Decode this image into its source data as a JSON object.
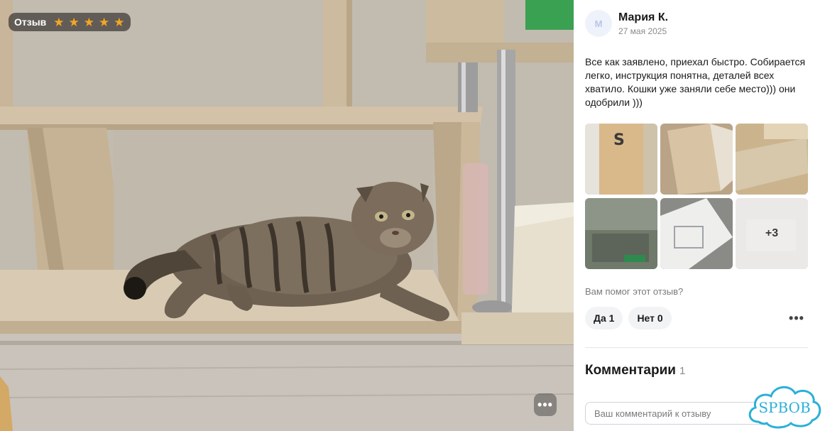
{
  "photo": {
    "rating_label": "Отзыв",
    "rating_value": 5,
    "more_icon": "ellipsis-icon"
  },
  "review": {
    "author": {
      "initials": "М",
      "name": "Мария К.",
      "date": "27 мая 2025"
    },
    "text": "Все как заявлено, приехал быстро. Собирается легко, инструкция понятна, деталей всех хватило. Кошки уже заняли себе место))) они одобрили )))",
    "more_photos_label": "+3",
    "helpful_question": "Вам помог этот отзыв?",
    "vote_yes": "Да 1",
    "vote_no": "Нет 0",
    "menu_icon": "more-horizontal-icon"
  },
  "comments": {
    "title": "Комментарии",
    "count": "1",
    "input_placeholder": "Ваш комментарий к отзыву"
  },
  "watermark": {
    "text": "SPBOB"
  },
  "colors": {
    "star": "#f5a623",
    "pill_bg": "#3c3834",
    "button_bg": "#f2f3f5",
    "watermark": "#2bb0d8"
  }
}
